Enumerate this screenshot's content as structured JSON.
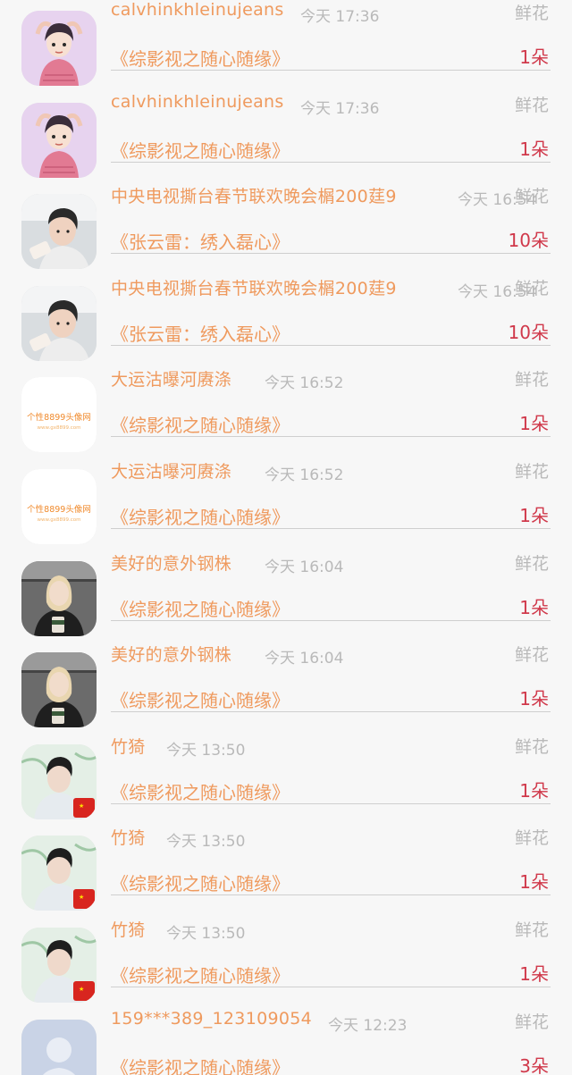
{
  "gift_colors": {
    "name": "#ef9a5e",
    "time": "#b9b9b9",
    "count": "#d0384a"
  },
  "rows": [
    {
      "avatar": "cartoon-girl-avatar",
      "name": "calvhinkhleinujeans",
      "time": "今天 17:36",
      "gift": "鲜花",
      "title": "《综影视之随心随缘》",
      "count": "1朵"
    },
    {
      "avatar": "cartoon-girl-avatar",
      "name": "calvhinkhleinujeans",
      "time": "今天 17:36",
      "gift": "鲜花",
      "title": "《综影视之随心随缘》",
      "count": "1朵"
    },
    {
      "avatar": "boy-photo-avatar",
      "name": "中央电视撕台春节联欢晚会榍200莛9",
      "time": "今天 16:54",
      "gift": "鲜花",
      "title": "《张云雷：绣入磊心》",
      "count": "10朵"
    },
    {
      "avatar": "boy-photo-avatar",
      "name": "中央电视撕台春节联欢晚会榍200莛9",
      "time": "今天 16:54",
      "gift": "鲜花",
      "title": "《张云雷：绣入磊心》",
      "count": "10朵"
    },
    {
      "avatar": "text-logo-avatar",
      "avatar_text": "个性8899头像网",
      "avatar_subtext": "www.gx8899.com",
      "name": "大运沽曝河赓涤",
      "time": "今天 16:52",
      "gift": "鲜花",
      "title": "《综影视之随心随缘》",
      "count": "1朵"
    },
    {
      "avatar": "text-logo-avatar",
      "avatar_text": "个性8899头像网",
      "avatar_subtext": "www.gx8899.com",
      "name": "大运沽曝河赓涤",
      "time": "今天 16:52",
      "gift": "鲜花",
      "title": "《综影视之随心随缘》",
      "count": "1朵"
    },
    {
      "avatar": "woman-photo-avatar",
      "name": "美好的意外钢株",
      "time": "今天 16:04",
      "gift": "鲜花",
      "title": "《综影视之随心随缘》",
      "count": "1朵"
    },
    {
      "avatar": "woman-photo-avatar",
      "name": "美好的意外钢株",
      "time": "今天 16:04",
      "gift": "鲜花",
      "title": "《综影视之随心随缘》",
      "count": "1朵"
    },
    {
      "avatar": "man-flag-avatar",
      "name": "竹猗",
      "time": "今天 13:50",
      "gift": "鲜花",
      "title": "《综影视之随心随缘》",
      "count": "1朵"
    },
    {
      "avatar": "man-flag-avatar",
      "name": "竹猗",
      "time": "今天 13:50",
      "gift": "鲜花",
      "title": "《综影视之随心随缘》",
      "count": "1朵"
    },
    {
      "avatar": "man-flag-avatar",
      "name": "竹猗",
      "time": "今天 13:50",
      "gift": "鲜花",
      "title": "《综影视之随心随缘》",
      "count": "1朵"
    },
    {
      "avatar": "default-user-avatar",
      "name": "159***389_123109054",
      "time": "今天 12:23",
      "gift": "鲜花",
      "title": "《综影视之随心随缘》",
      "count": "3朵"
    }
  ]
}
